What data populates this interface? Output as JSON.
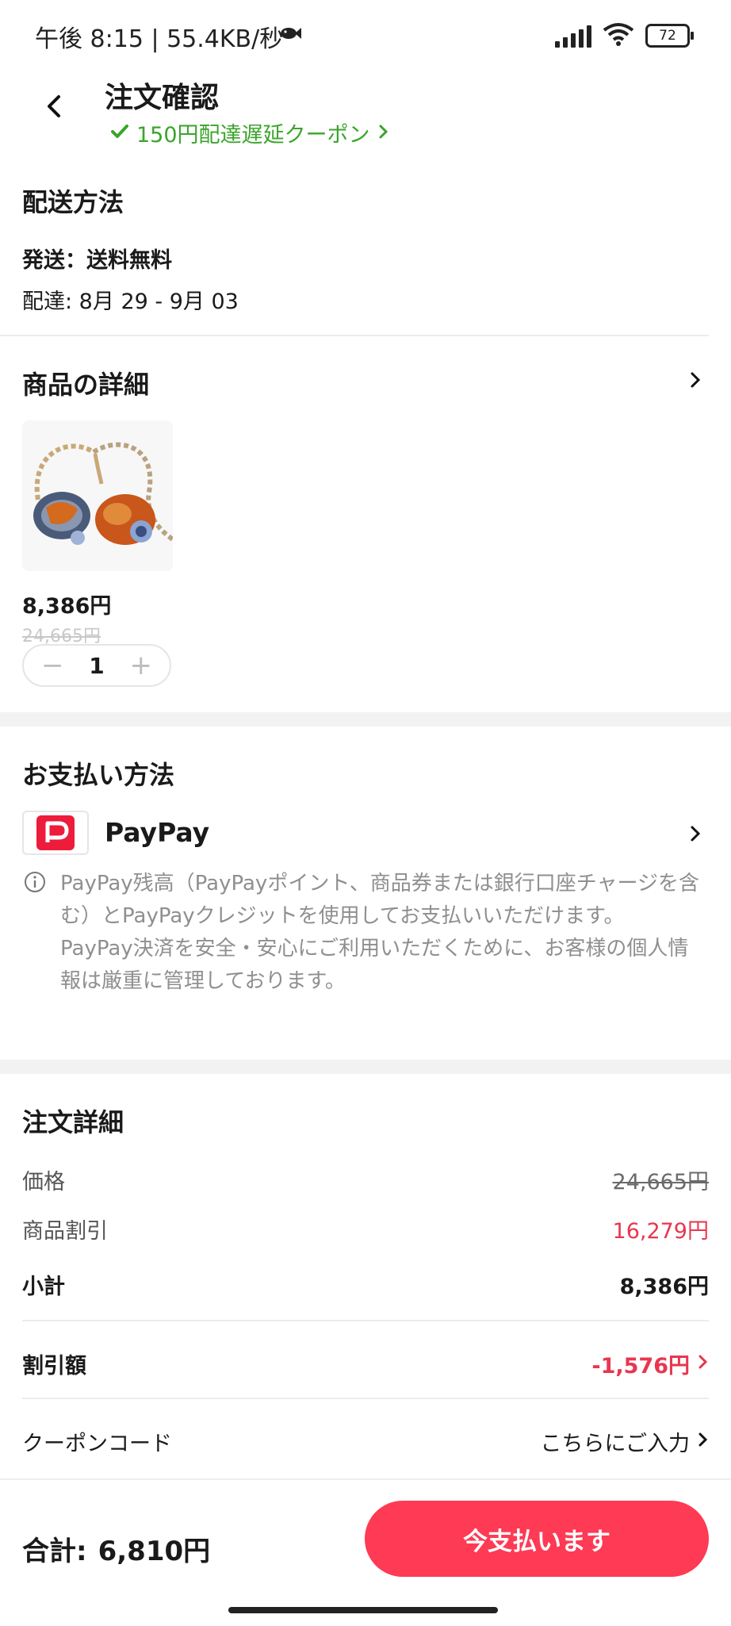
{
  "status_bar": {
    "time_speed": "午後 8:15 | 55.4KB/秒",
    "battery": "72"
  },
  "header": {
    "title": "注文確認",
    "coupon_text": "150円配達遅延クーポン"
  },
  "shipping": {
    "title": "配送方法",
    "ship": "発送：送料無料",
    "delivery": "配達: 8月 29 - 9月 03"
  },
  "product": {
    "title": "商品の詳細",
    "price": "8,386円",
    "original_price": "24,665円",
    "quantity": "1"
  },
  "payment": {
    "title": "お支払い方法",
    "method": "PayPay",
    "info_line1": "PayPay残高（PayPayポイント、商品券または銀行口座チャージを含む）とPayPayクレジットを使用してお支払いいただけます。",
    "info_line2": "PayPay決済を安全・安心にご利用いただくために、お客様の個人情報は厳重に管理しております。"
  },
  "order": {
    "title": "注文詳細",
    "rows": [
      {
        "label": "価格",
        "value": "24,665円"
      },
      {
        "label": "商品割引",
        "value": "16,279円"
      },
      {
        "label": "小計",
        "value": "8,386円"
      },
      {
        "label": "割引額",
        "value": "-1,576円"
      },
      {
        "label": "クーポンコード",
        "value": "こちらにご入力"
      }
    ]
  },
  "footer": {
    "total_label": "合計:",
    "total_value": "6,810円",
    "pay_button": "今支払います"
  },
  "colors": {
    "accent": "#fe3a54",
    "discount_red": "#e8364f",
    "coupon_green": "#3aa52a"
  },
  "icons": [
    "back-arrow-icon",
    "check-icon",
    "chevron-right-icon",
    "paypay-logo-icon",
    "info-icon",
    "signal-icon",
    "wifi-icon",
    "battery-icon",
    "fish-icon"
  ]
}
